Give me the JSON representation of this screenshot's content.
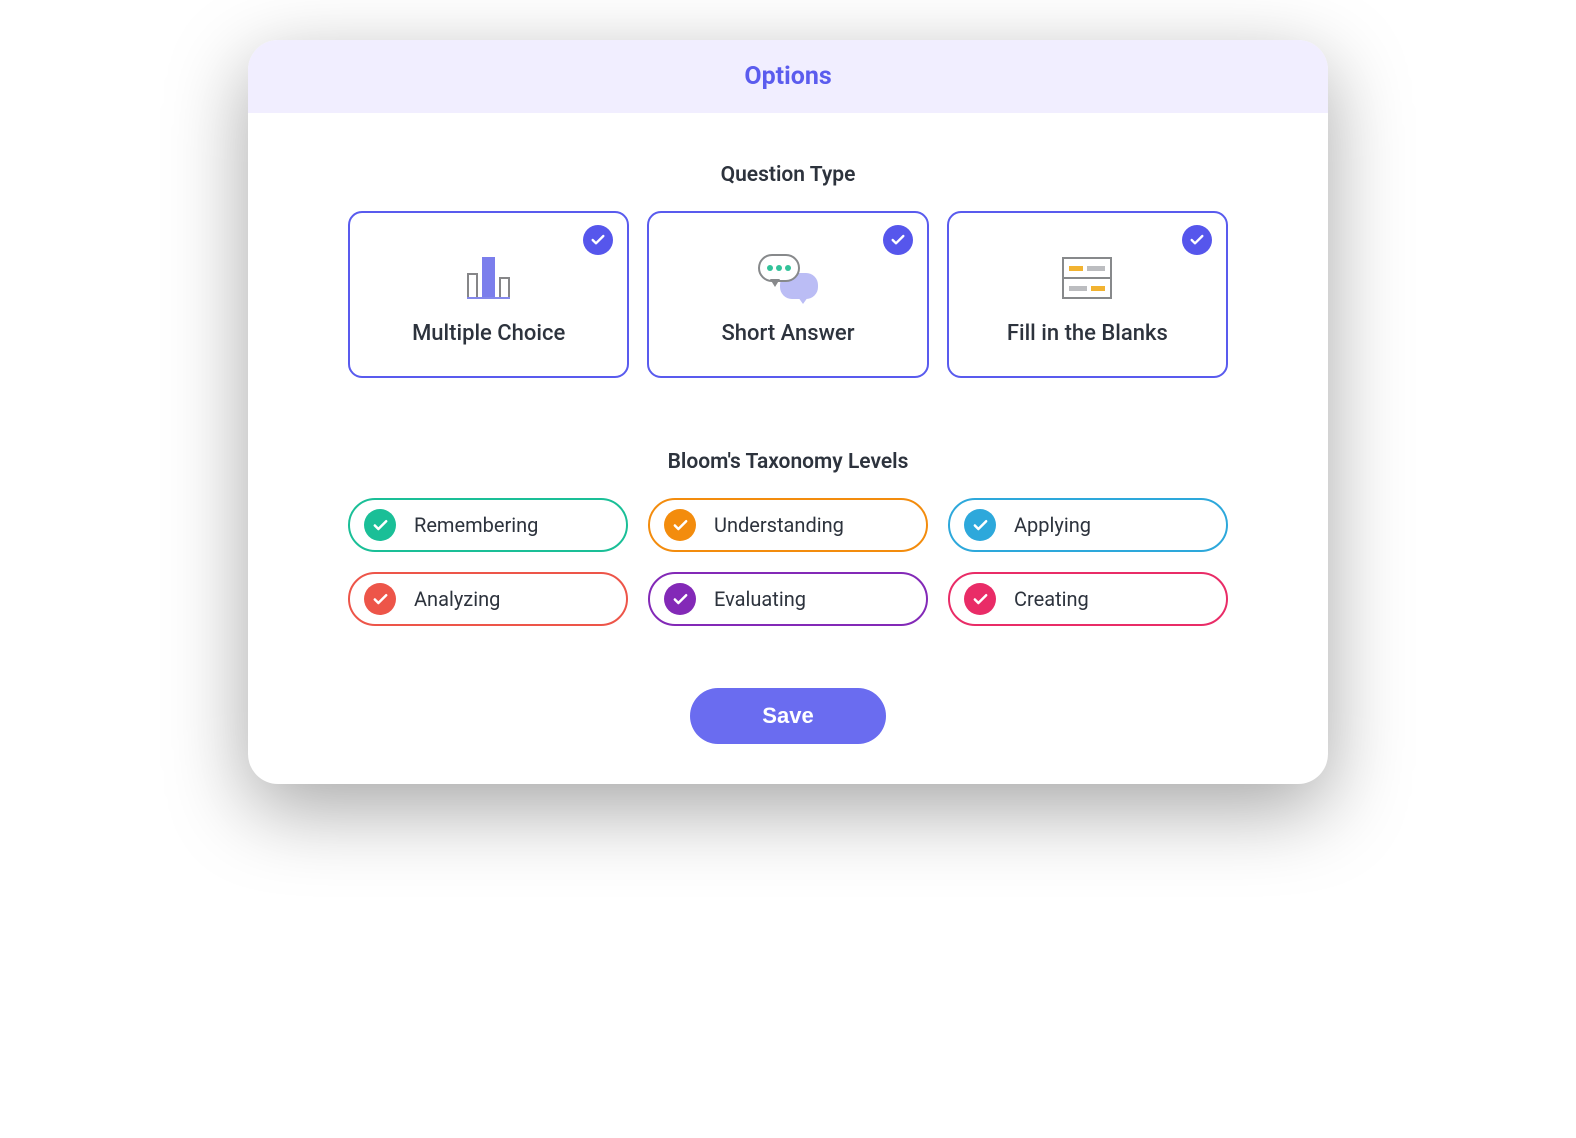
{
  "header": {
    "title": "Options"
  },
  "questionType": {
    "title": "Question Type",
    "items": [
      {
        "label": "Multiple Choice",
        "icon": "bars",
        "selected": true
      },
      {
        "label": "Short Answer",
        "icon": "chat",
        "selected": true
      },
      {
        "label": "Fill in the Blanks",
        "icon": "form",
        "selected": true
      }
    ]
  },
  "taxonomy": {
    "title": "Bloom's Taxonomy Levels",
    "items": [
      {
        "label": "Remembering",
        "color": "#1abf97",
        "selected": true
      },
      {
        "label": "Understanding",
        "color": "#f38c0d",
        "selected": true
      },
      {
        "label": "Applying",
        "color": "#2da8db",
        "selected": true
      },
      {
        "label": "Analyzing",
        "color": "#ed5549",
        "selected": true
      },
      {
        "label": "Evaluating",
        "color": "#8329b7",
        "selected": true
      },
      {
        "label": "Creating",
        "color": "#e92c67",
        "selected": true
      }
    ]
  },
  "actions": {
    "save_label": "Save"
  },
  "colors": {
    "accent": "#5b5cee",
    "header_bg": "#f1eeff"
  }
}
